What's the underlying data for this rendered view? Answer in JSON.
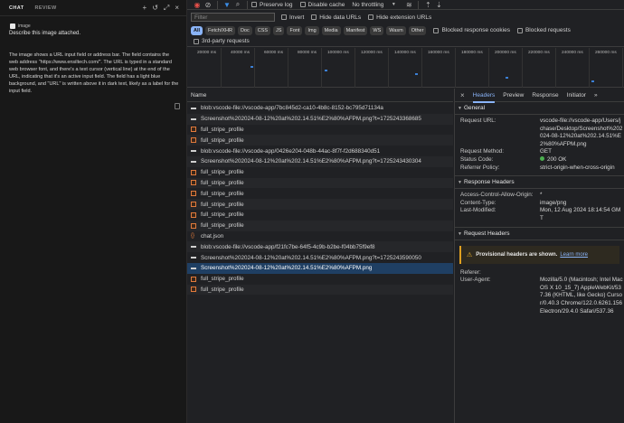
{
  "chat": {
    "tabs": [
      "CHAT",
      "REVIEW"
    ],
    "image_chip": "image",
    "prompt": "Describe this image attached.",
    "answer": "The image shows a URL input field or address bar. The field contains the web address \"https://www.ensiltech.com/\". The URL is typed in a standard web browser font, and there's a text cursor (vertical line) at the end of the URL, indicating that it's an active input field. The field has a light blue background, and \"URL\" is written above it in dark text, likely as a label for the input field."
  },
  "toolbar": {
    "preserve_log": "Preserve log",
    "disable_cache": "Disable cache",
    "throttling": "No throttling"
  },
  "filterbar": {
    "placeholder": "Filter",
    "invert": "Invert",
    "hide_data_urls": "Hide data URLs",
    "hide_extension_urls": "Hide extension URLs"
  },
  "typebar": {
    "chips": [
      "All",
      "Fetch/XHR",
      "Doc",
      "CSS",
      "JS",
      "Font",
      "Img",
      "Media",
      "Manifest",
      "WS",
      "Wasm",
      "Other"
    ],
    "blocked_cookies": "Blocked response cookies",
    "blocked_requests": "Blocked requests",
    "third_party": "3rd-party requests"
  },
  "timeline": {
    "ticks": [
      "20000 ms",
      "40000 ms",
      "60000 ms",
      "80000 ms",
      "100000 ms",
      "120000 ms",
      "140000 ms",
      "160000 ms",
      "180000 ms",
      "200000 ms",
      "220000 ms",
      "240000 ms",
      "260000 ms"
    ]
  },
  "list": {
    "header": "Name",
    "requests": [
      {
        "type": "doc",
        "name": "blob:vscode-file://vscode-app/7bc845d2-ca10-4b8c-8152-bc795d71134a"
      },
      {
        "type": "doc",
        "name": "Screenshot%202024-08-12%20at%202.14.51%E2%80%AFPM.png?t=1725243368685"
      },
      {
        "type": "img",
        "name": "full_stripe_profile"
      },
      {
        "type": "img",
        "name": "full_stripe_profile"
      },
      {
        "type": "doc",
        "name": "blob:vscode-file://vscode-app/0426e204-048b-44ac-8f7f-f2d688340d51"
      },
      {
        "type": "doc",
        "name": "Screenshot%202024-08-12%20at%202.14.51%E2%80%AFPM.png?t=1725243430304"
      },
      {
        "type": "img",
        "name": "full_stripe_profile"
      },
      {
        "type": "img",
        "name": "full_stripe_profile"
      },
      {
        "type": "img",
        "name": "full_stripe_profile"
      },
      {
        "type": "img",
        "name": "full_stripe_profile"
      },
      {
        "type": "img",
        "name": "full_stripe_profile"
      },
      {
        "type": "img",
        "name": "full_stripe_profile"
      },
      {
        "type": "json",
        "name": "chat.json"
      },
      {
        "type": "doc",
        "name": "blob:vscode-file://vscode-app/f21fc7be-64f5-4c9b-b2be-f04bb75f9ef8"
      },
      {
        "type": "doc",
        "name": "Screenshot%202024-08-12%20at%202.14.51%E2%80%AFPM.png?t=1725243590050"
      },
      {
        "type": "doc",
        "name": "Screenshot%202024-08-12%20at%202.14.51%E2%80%AFPM.png",
        "selected": true
      },
      {
        "type": "img",
        "name": "full_stripe_profile"
      },
      {
        "type": "img",
        "name": "full_stripe_profile"
      }
    ]
  },
  "details": {
    "tabs": [
      "Headers",
      "Preview",
      "Response",
      "Initiator"
    ],
    "general_title": "General",
    "general": [
      {
        "k": "Request URL:",
        "v": "vscode-file://vscode-app/Users/jchase/Desktop/Screenshot%202024-08-12%20at%202.14.51%E2%80%AFPM.png"
      },
      {
        "k": "Request Method:",
        "v": "GET"
      },
      {
        "k": "Status Code:",
        "v": "200 OK"
      },
      {
        "k": "Referrer Policy:",
        "v": "strict-origin-when-cross-origin"
      }
    ],
    "response_title": "Response Headers",
    "response": [
      {
        "k": "Access-Control-Allow-Origin:",
        "v": "*"
      },
      {
        "k": "Content-Type:",
        "v": "image/png"
      },
      {
        "k": "Last-Modified:",
        "v": "Mon, 12 Aug 2024 18:14:54 GMT"
      }
    ],
    "request_title": "Request Headers",
    "provisional_msg": "Provisional headers are shown.",
    "learn_more": "Learn more",
    "request": [
      {
        "k": "Referer:",
        "v": ""
      },
      {
        "k": "User-Agent:",
        "v": "Mozilla/5.0 (Macintosh; Intel Mac OS X 10_15_7) AppleWebKit/537.36 (KHTML, like Gecko) Cursor/0.40.3 Chrome/122.0.6261.156 Electron/29.4.0 Safari/537.36"
      }
    ]
  }
}
